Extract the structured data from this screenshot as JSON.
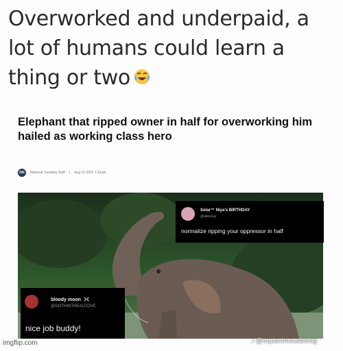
{
  "caption": {
    "text": "Overworked and underpaid, a lot of humans could learn a thing or two",
    "emoji": "face-with-tears-of-joy"
  },
  "article": {
    "headline": "Elephant that ripped owner in half for overworking him hailed as working class hero",
    "logo_text": "DN",
    "byline": "National Trending Staff",
    "date": "Aug 10 2022 1:31am"
  },
  "tweets": [
    {
      "name": "Solar™ Niya's BIRTHDAY",
      "handle": "@afeezaa",
      "message": "normalize ripping your oppressor in half",
      "avatar_color": "#d9a3b5"
    },
    {
      "name": "bloody moon ☽☾",
      "handle": "@GOTHINTHEALCOVE",
      "message": "nice job buddy!",
      "avatar_color": "#a8322f"
    }
  ],
  "watermarks": {
    "imgflip": "imgflip.com",
    "tiktok": "@equanimousbeing"
  },
  "colors": {
    "caption_text": "#2a2a2a",
    "tweet_bg": "#000000",
    "photo_bg": "#1f3a22",
    "elephant": "#6f6157"
  }
}
